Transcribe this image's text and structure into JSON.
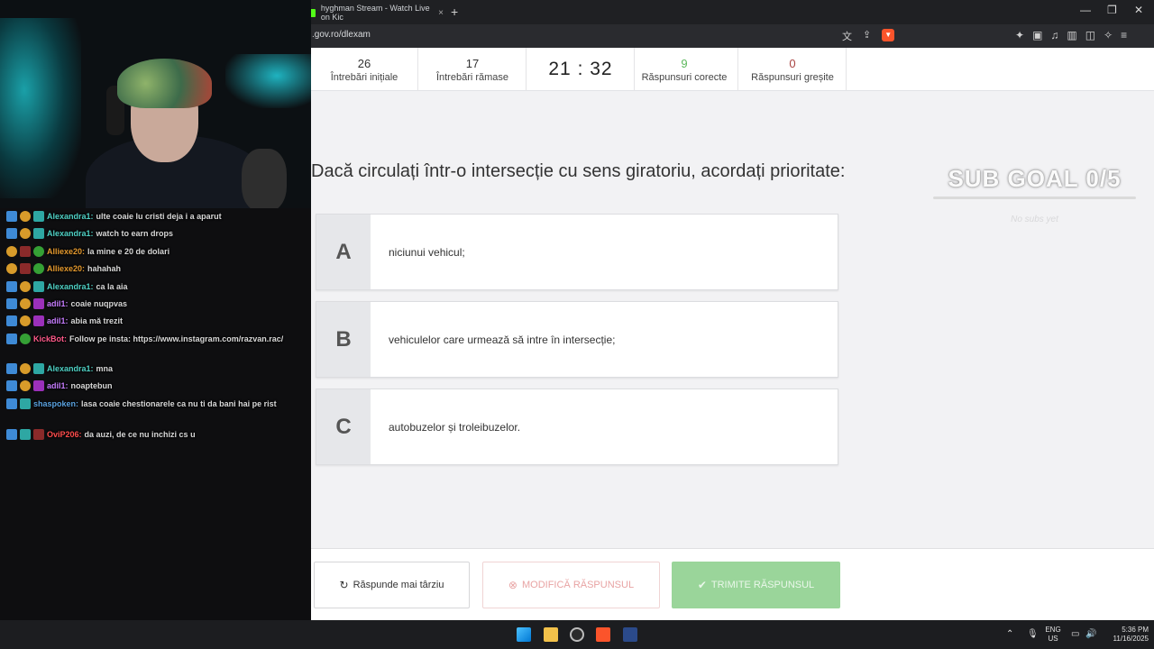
{
  "browser": {
    "tab_title": "hyghman Stream - Watch Live on Kic",
    "tab_close": "×",
    "new_tab": "+",
    "url": ".gov.ro/dlexam",
    "window_controls": [
      "—",
      "❐",
      "✕"
    ]
  },
  "stats": [
    {
      "value": "26",
      "label": "Întrebări inițiale"
    },
    {
      "value": "17",
      "label": "Întrebări rămase"
    },
    {
      "value": "21 : 32",
      "label": ""
    },
    {
      "value": "9",
      "label": "Răspunsuri corecte"
    },
    {
      "value": "0",
      "label": "Răspunsuri greșite"
    }
  ],
  "question": "Dacă circulați într-o intersecție cu sens giratoriu, acordați prioritate:",
  "options": [
    {
      "letter": "A",
      "text": "niciunui vehicul;"
    },
    {
      "letter": "B",
      "text": "vehiculelor care urmează să intre în intersecție;"
    },
    {
      "letter": "C",
      "text": "autobuzelor și troleibuzelor."
    }
  ],
  "overlay": {
    "sub_goal": "SUB GOAL 0/5",
    "sub_text": "No subs yet"
  },
  "buttons": {
    "later": "Răspunde mai târziu",
    "modify": "MODIFICĂ RĂSPUNSUL",
    "submit": "TRIMITE RĂSPUNSUL"
  },
  "chat": [
    {
      "user": "Alexandra1:",
      "text": "ulte coaie lu cristi deja i a aparut",
      "color": "#4fd1c5"
    },
    {
      "user": "Alexandra1:",
      "text": "watch to earn drops",
      "color": "#4fd1c5"
    },
    {
      "user": "Alliexe20:",
      "text": "la mine e 20 de dolari",
      "color": "#e59a2f"
    },
    {
      "user": "Alliexe20:",
      "text": "hahahah",
      "color": "#e59a2f"
    },
    {
      "user": "Alexandra1:",
      "text": "ca la aia",
      "color": "#4fd1c5"
    },
    {
      "user": "adil1:",
      "text": "coaie nuqpvas",
      "color": "#c77dff"
    },
    {
      "user": "adil1:",
      "text": "abia mă trezit",
      "color": "#c77dff"
    },
    {
      "user": "KickBot:",
      "text": "Follow pe insta: https://www.instagram.com/razvan.rac/",
      "color": "#ff5a8a"
    },
    {
      "user": "Alexandra1:",
      "text": "mna",
      "color": "#4fd1c5"
    },
    {
      "user": "adil1:",
      "text": "noaptebun",
      "color": "#c77dff"
    },
    {
      "user": "shaspoken:",
      "text": "lasa coaie chestionarele ca nu ti da bani hai pe rist",
      "color": "#5aa2e0"
    },
    {
      "user": "OviP206:",
      "text": "da auzi, de ce nu inchizi cs u",
      "color": "#ff4d4d"
    }
  ],
  "taskbar": {
    "lang_top": "ENG",
    "lang_bottom": "US",
    "time": "5:36 PM",
    "date": "11/16/2025"
  }
}
